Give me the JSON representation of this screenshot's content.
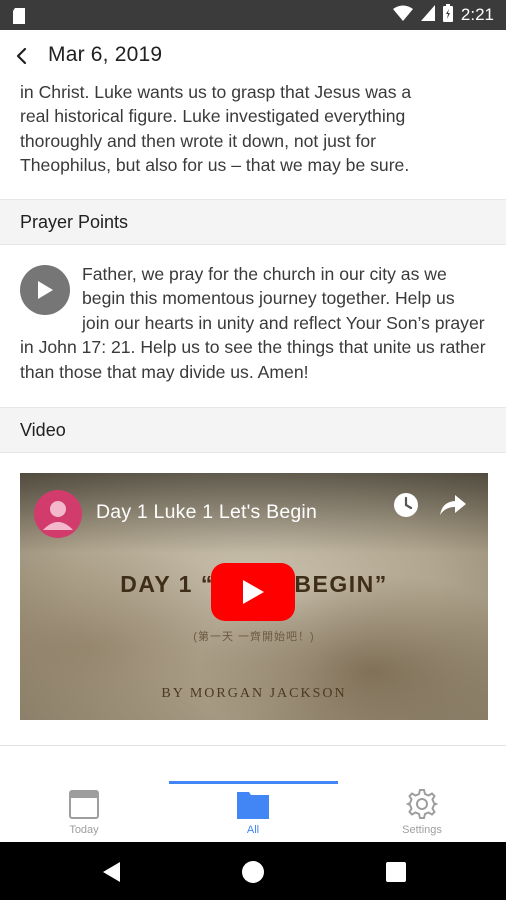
{
  "status_bar": {
    "time": "2:21"
  },
  "app_bar": {
    "title": "Mar 6, 2019"
  },
  "intro_lines": [
    "in Christ. Luke wants us to grasp that Jesus was a",
    "real historical figure. Luke investigated everything",
    "thoroughly and then wrote it down, not just for",
    "Theophilus, but also for us – that we may be sure."
  ],
  "sections": {
    "prayer_header": "Prayer Points",
    "prayer_text": "Father, we pray for the church in our city as we begin this momentous journey together. Help us join our hearts in unity and reflect Your Son’s prayer in John 17: 21. Help us to see the things that unite us rather than those that may divide us. Amen!",
    "video_header": "Video"
  },
  "video": {
    "title": "Day 1 Luke 1 Let's Begin",
    "thumb_heading": "DAY 1 “LET’S BEGIN”",
    "thumb_subtitle": "(第一天 一齊開始吧！)",
    "thumb_author": "BY MORGAN JACKSON"
  },
  "bottom_nav": {
    "today": "Today",
    "all": "All",
    "settings": "Settings",
    "active_color": "#4285f4",
    "inactive_color": "#9e9e9e"
  }
}
